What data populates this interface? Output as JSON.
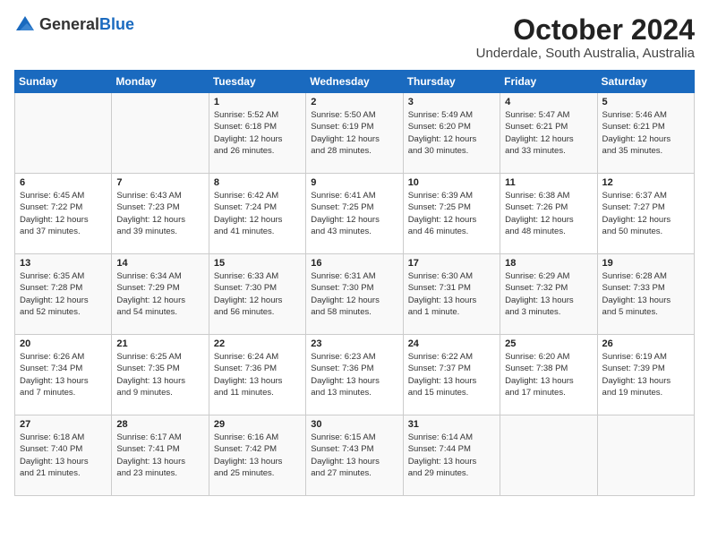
{
  "logo": {
    "general": "General",
    "blue": "Blue"
  },
  "title": "October 2024",
  "location": "Underdale, South Australia, Australia",
  "headers": [
    "Sunday",
    "Monday",
    "Tuesday",
    "Wednesday",
    "Thursday",
    "Friday",
    "Saturday"
  ],
  "weeks": [
    [
      {
        "day": "",
        "info": ""
      },
      {
        "day": "",
        "info": ""
      },
      {
        "day": "1",
        "info": "Sunrise: 5:52 AM\nSunset: 6:18 PM\nDaylight: 12 hours\nand 26 minutes."
      },
      {
        "day": "2",
        "info": "Sunrise: 5:50 AM\nSunset: 6:19 PM\nDaylight: 12 hours\nand 28 minutes."
      },
      {
        "day": "3",
        "info": "Sunrise: 5:49 AM\nSunset: 6:20 PM\nDaylight: 12 hours\nand 30 minutes."
      },
      {
        "day": "4",
        "info": "Sunrise: 5:47 AM\nSunset: 6:21 PM\nDaylight: 12 hours\nand 33 minutes."
      },
      {
        "day": "5",
        "info": "Sunrise: 5:46 AM\nSunset: 6:21 PM\nDaylight: 12 hours\nand 35 minutes."
      }
    ],
    [
      {
        "day": "6",
        "info": "Sunrise: 6:45 AM\nSunset: 7:22 PM\nDaylight: 12 hours\nand 37 minutes."
      },
      {
        "day": "7",
        "info": "Sunrise: 6:43 AM\nSunset: 7:23 PM\nDaylight: 12 hours\nand 39 minutes."
      },
      {
        "day": "8",
        "info": "Sunrise: 6:42 AM\nSunset: 7:24 PM\nDaylight: 12 hours\nand 41 minutes."
      },
      {
        "day": "9",
        "info": "Sunrise: 6:41 AM\nSunset: 7:25 PM\nDaylight: 12 hours\nand 43 minutes."
      },
      {
        "day": "10",
        "info": "Sunrise: 6:39 AM\nSunset: 7:25 PM\nDaylight: 12 hours\nand 46 minutes."
      },
      {
        "day": "11",
        "info": "Sunrise: 6:38 AM\nSunset: 7:26 PM\nDaylight: 12 hours\nand 48 minutes."
      },
      {
        "day": "12",
        "info": "Sunrise: 6:37 AM\nSunset: 7:27 PM\nDaylight: 12 hours\nand 50 minutes."
      }
    ],
    [
      {
        "day": "13",
        "info": "Sunrise: 6:35 AM\nSunset: 7:28 PM\nDaylight: 12 hours\nand 52 minutes."
      },
      {
        "day": "14",
        "info": "Sunrise: 6:34 AM\nSunset: 7:29 PM\nDaylight: 12 hours\nand 54 minutes."
      },
      {
        "day": "15",
        "info": "Sunrise: 6:33 AM\nSunset: 7:30 PM\nDaylight: 12 hours\nand 56 minutes."
      },
      {
        "day": "16",
        "info": "Sunrise: 6:31 AM\nSunset: 7:30 PM\nDaylight: 12 hours\nand 58 minutes."
      },
      {
        "day": "17",
        "info": "Sunrise: 6:30 AM\nSunset: 7:31 PM\nDaylight: 13 hours\nand 1 minute."
      },
      {
        "day": "18",
        "info": "Sunrise: 6:29 AM\nSunset: 7:32 PM\nDaylight: 13 hours\nand 3 minutes."
      },
      {
        "day": "19",
        "info": "Sunrise: 6:28 AM\nSunset: 7:33 PM\nDaylight: 13 hours\nand 5 minutes."
      }
    ],
    [
      {
        "day": "20",
        "info": "Sunrise: 6:26 AM\nSunset: 7:34 PM\nDaylight: 13 hours\nand 7 minutes."
      },
      {
        "day": "21",
        "info": "Sunrise: 6:25 AM\nSunset: 7:35 PM\nDaylight: 13 hours\nand 9 minutes."
      },
      {
        "day": "22",
        "info": "Sunrise: 6:24 AM\nSunset: 7:36 PM\nDaylight: 13 hours\nand 11 minutes."
      },
      {
        "day": "23",
        "info": "Sunrise: 6:23 AM\nSunset: 7:36 PM\nDaylight: 13 hours\nand 13 minutes."
      },
      {
        "day": "24",
        "info": "Sunrise: 6:22 AM\nSunset: 7:37 PM\nDaylight: 13 hours\nand 15 minutes."
      },
      {
        "day": "25",
        "info": "Sunrise: 6:20 AM\nSunset: 7:38 PM\nDaylight: 13 hours\nand 17 minutes."
      },
      {
        "day": "26",
        "info": "Sunrise: 6:19 AM\nSunset: 7:39 PM\nDaylight: 13 hours\nand 19 minutes."
      }
    ],
    [
      {
        "day": "27",
        "info": "Sunrise: 6:18 AM\nSunset: 7:40 PM\nDaylight: 13 hours\nand 21 minutes."
      },
      {
        "day": "28",
        "info": "Sunrise: 6:17 AM\nSunset: 7:41 PM\nDaylight: 13 hours\nand 23 minutes."
      },
      {
        "day": "29",
        "info": "Sunrise: 6:16 AM\nSunset: 7:42 PM\nDaylight: 13 hours\nand 25 minutes."
      },
      {
        "day": "30",
        "info": "Sunrise: 6:15 AM\nSunset: 7:43 PM\nDaylight: 13 hours\nand 27 minutes."
      },
      {
        "day": "31",
        "info": "Sunrise: 6:14 AM\nSunset: 7:44 PM\nDaylight: 13 hours\nand 29 minutes."
      },
      {
        "day": "",
        "info": ""
      },
      {
        "day": "",
        "info": ""
      }
    ]
  ]
}
